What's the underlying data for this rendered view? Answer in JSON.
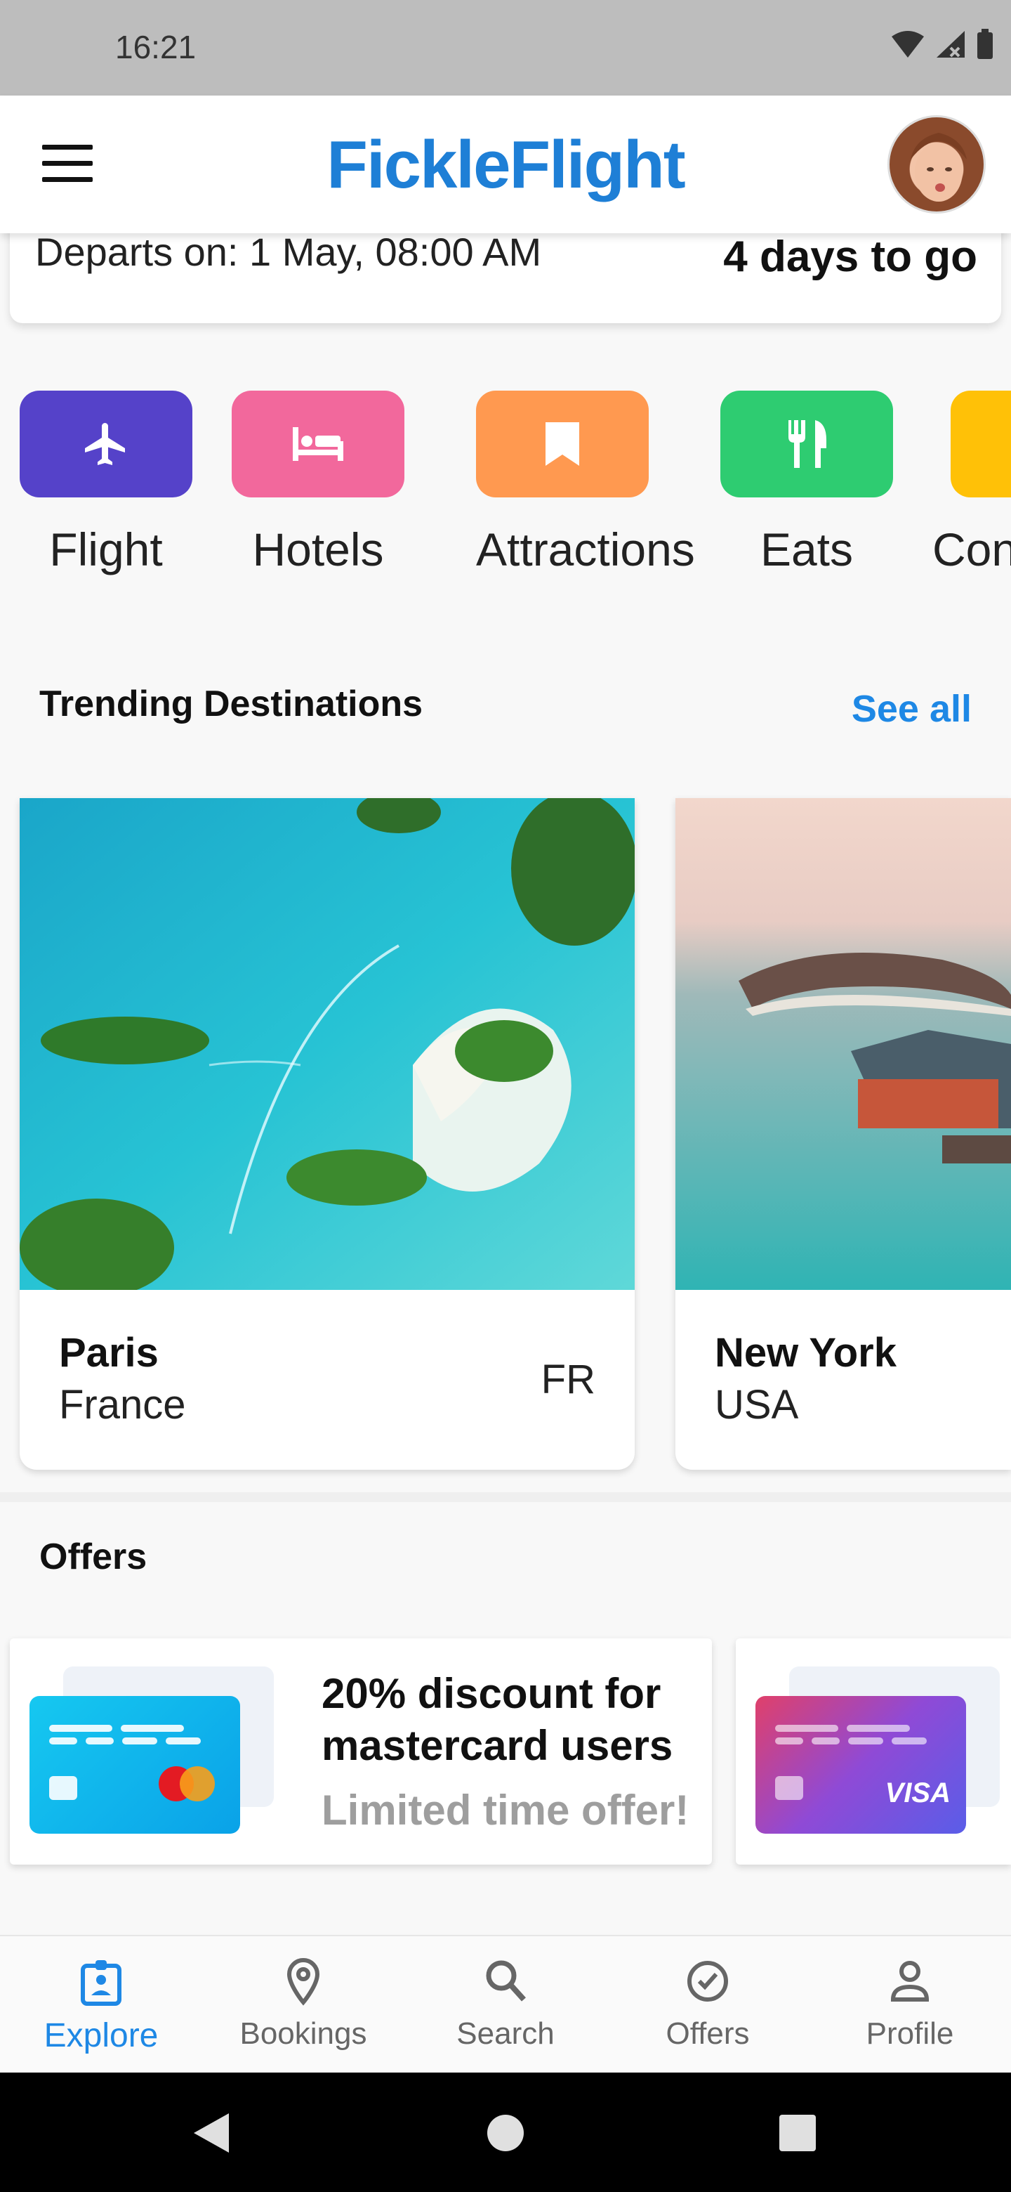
{
  "status_bar": {
    "time": "16:21"
  },
  "app_bar": {
    "logo": "FickleFlight"
  },
  "trip": {
    "departs": "Departs on: 1 May, 08:00 AM",
    "countdown": "4 days to go"
  },
  "categories": [
    {
      "label": "Flight",
      "color": "#5542c9",
      "icon": "airplane-icon"
    },
    {
      "label": "Hotels",
      "color": "#f2689c",
      "icon": "bed-icon"
    },
    {
      "label": "Attractions",
      "color": "#ff9950",
      "icon": "bookmark-icon"
    },
    {
      "label": "Eats",
      "color": "#2ecc71",
      "icon": "cutlery-icon"
    },
    {
      "label": "Con",
      "color": "#ffc107",
      "icon": "unknown-icon"
    }
  ],
  "trending": {
    "title": "Trending Destinations",
    "see_all": "See all",
    "items": [
      {
        "city": "Paris",
        "country": "France",
        "code": "FR"
      },
      {
        "city": "New York",
        "country": "USA",
        "code": ""
      }
    ]
  },
  "offers": {
    "title": "Offers",
    "items": [
      {
        "headline": "20% discount for mastercard users",
        "sub": "Limited time offer!",
        "card_brand": "mastercard"
      },
      {
        "headline": "",
        "sub": "",
        "card_brand": "VISA"
      }
    ]
  },
  "bottom_nav": [
    {
      "label": "Explore",
      "active": true,
      "icon": "explore-icon"
    },
    {
      "label": "Bookings",
      "active": false,
      "icon": "location-pin-icon"
    },
    {
      "label": "Search",
      "active": false,
      "icon": "search-icon"
    },
    {
      "label": "Offers",
      "active": false,
      "icon": "check-circle-icon"
    },
    {
      "label": "Profile",
      "active": false,
      "icon": "person-icon"
    }
  ],
  "colors": {
    "accent": "#1e88e5",
    "logo": "#1e7fd6"
  }
}
